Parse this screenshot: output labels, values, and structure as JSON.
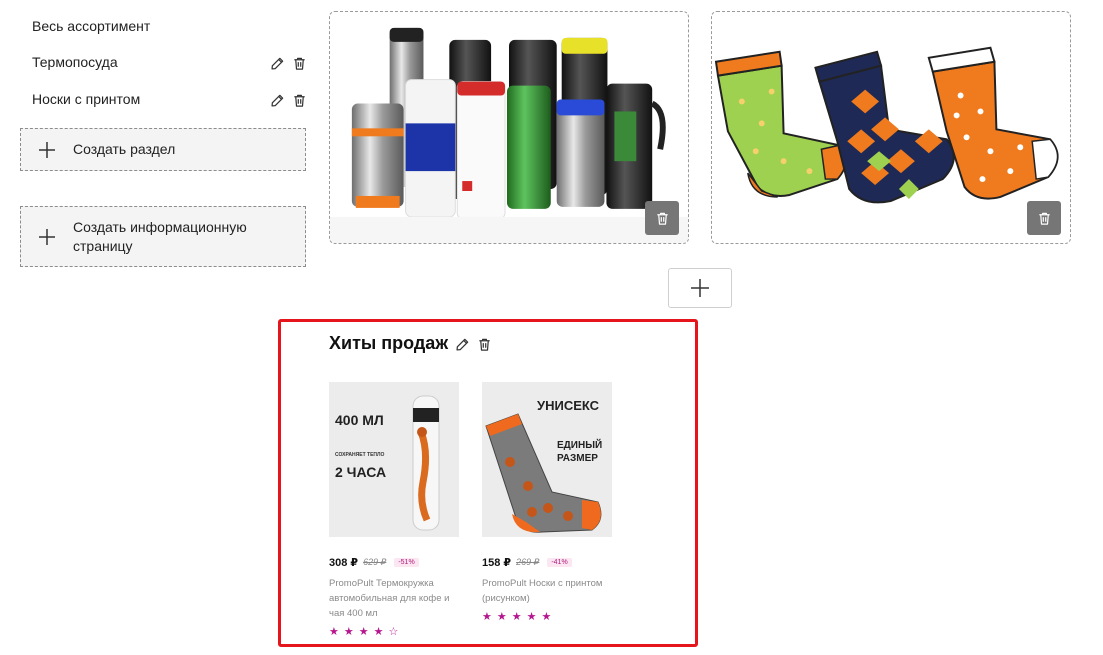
{
  "sidebar": {
    "items": [
      {
        "label": "Весь ассортимент"
      },
      {
        "label": "Термопосуда"
      },
      {
        "label": "Носки с принтом"
      }
    ],
    "create_section": "Создать раздел",
    "create_info_page": "Создать информационную страницу"
  },
  "categories": [
    {
      "name": "thermo",
      "icon": "trash-icon"
    },
    {
      "name": "socks",
      "icon": "trash-icon"
    }
  ],
  "add_block_icon": "plus-icon",
  "hits": {
    "title": "Хиты продаж",
    "products": [
      {
        "image_text": {
          "l1": "400 МЛ",
          "l2": "СОХРАНЯЕТ ТЕПЛО",
          "l3": "2 ЧАСА"
        },
        "price": "308 ₽",
        "old_price": "629 ₽",
        "discount": "-51%",
        "name": "PromoPult Термокружка автомобильная для кофе и чая 400 мл",
        "rating": 4
      },
      {
        "image_text": {
          "l1": "УНИСЕКС",
          "l2": "ЕДИНЫЙ",
          "l3": "РАЗМЕР"
        },
        "price": "158 ₽",
        "old_price": "269 ₽",
        "discount": "-41%",
        "name": "PromoPult Носки с принтом (рисунком)",
        "rating": 5
      }
    ]
  },
  "colors": {
    "highlight_border": "#e6141b",
    "star": "#b5168f",
    "delete_button": "#767676"
  }
}
